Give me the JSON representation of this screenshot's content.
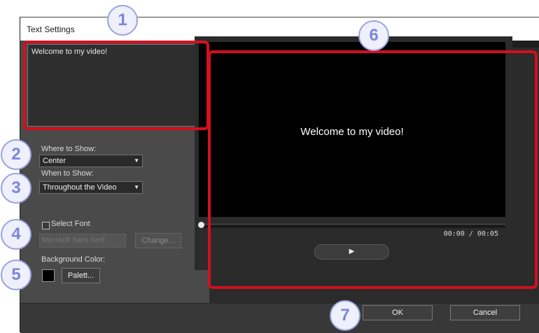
{
  "dialog": {
    "title": "Text Settings"
  },
  "text_input": {
    "value": "Welcome to my video!"
  },
  "where_to_show": {
    "label": "Where to Show:",
    "selected": "Center"
  },
  "when_to_show": {
    "label": "When to Show:",
    "selected": "Throughout the Video"
  },
  "font": {
    "checkbox_label": "Select Font",
    "checked": false,
    "current_font": "Microsoft Sans Serif",
    "change_button": "Change..."
  },
  "background": {
    "label": "Background Color:",
    "color": "#000000",
    "palette_button": "Palett..."
  },
  "preview": {
    "text": "Welcome to my video!",
    "time_current": "00:00",
    "time_separator": "/",
    "time_total": "00:05",
    "position_fraction": 0.0,
    "play_icon": "play-icon",
    "play_glyph": "▶"
  },
  "footer": {
    "ok_label": "OK",
    "cancel_label": "Cancel"
  },
  "callouts": [
    "1",
    "2",
    "3",
    "4",
    "5",
    "6",
    "7"
  ],
  "colors": {
    "highlight": "#d50f1f",
    "callout_text": "#7c86d8",
    "callout_bg": "#eef0fb"
  },
  "icons": {
    "dropdown": "chevron-down-icon",
    "dropdown_glyph": "▼"
  }
}
